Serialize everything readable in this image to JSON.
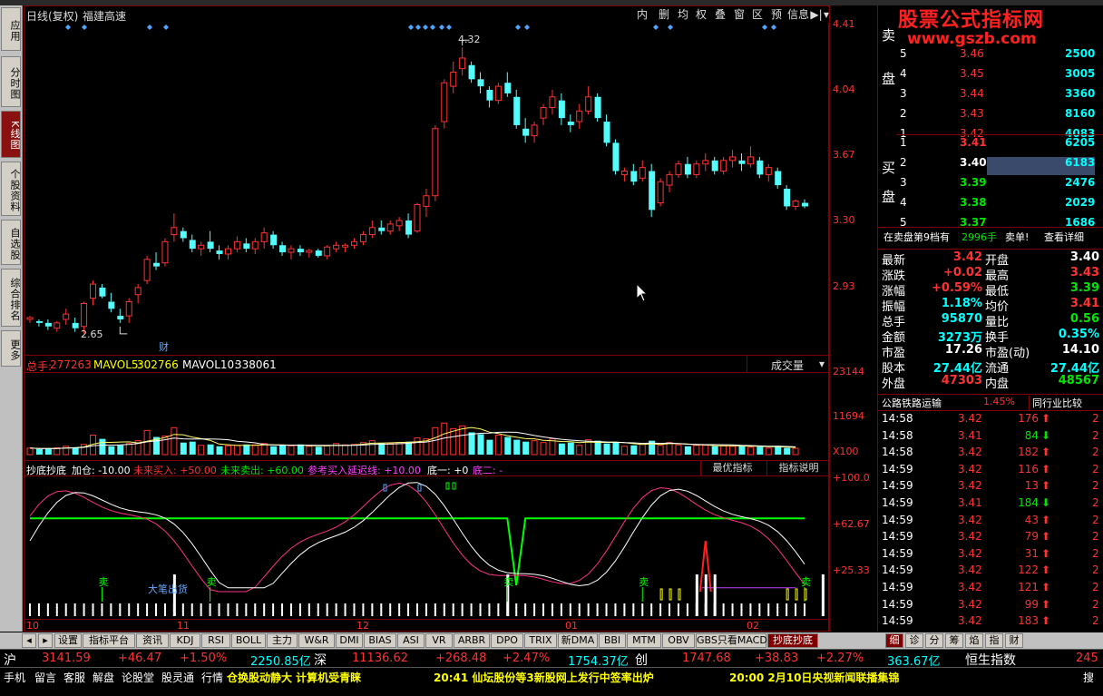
{
  "title": {
    "period": "日线(复权)",
    "stock": "福建高速"
  },
  "toolbar": [
    "内",
    "删",
    "均",
    "权",
    "叠",
    "窗",
    "区",
    "预",
    "信息",
    "▶|",
    "▾"
  ],
  "left_tabs": [
    {
      "label": "应用"
    },
    {
      "label": "分时图"
    },
    {
      "label": "K线图",
      "active": true
    },
    {
      "label": "个股资料"
    },
    {
      "label": "自选股"
    },
    {
      "label": "综合排名"
    },
    {
      "label": "更多"
    }
  ],
  "price_axis": [
    "4.41",
    "4.04",
    "3.67",
    "3.30",
    "2.93"
  ],
  "annotations": {
    "high": "4.32",
    "low": "2.65",
    "cai": "财"
  },
  "vol": {
    "zs_label": "总手:",
    "zs": "277263",
    "mavol5_label": "MAVOL5:",
    "mavol5": "302766",
    "mavol10_label": "MAVOL10:",
    "mavol10": "338061",
    "btn": "成交量",
    "axis": [
      "23144",
      "11694",
      "X100"
    ]
  },
  "ind": {
    "name": "抄底抄底",
    "p1": "加仓: -10.00",
    "p2": "未来买入: +50.00",
    "p3": "未来卖出: +60.00",
    "p4": "参考买入延迟线: +10.00",
    "p5": "底一: +0",
    "p6": "底二: -",
    "btn1": "最优指标",
    "btn2": "指标说明",
    "axis": [
      "+100.0",
      "+62.67",
      "+25.33"
    ],
    "sell": "卖",
    "bigsell": "大笔出货"
  },
  "months": [
    "10",
    "11",
    "12",
    "01",
    "02"
  ],
  "chart_data": {
    "type": "candlestick",
    "ylim": [
      2.6,
      4.45
    ],
    "candles": [
      [
        2.78,
        2.8,
        2.76,
        2.79
      ],
      [
        2.77,
        2.78,
        2.74,
        2.76
      ],
      [
        2.76,
        2.78,
        2.72,
        2.74
      ],
      [
        2.73,
        2.77,
        2.71,
        2.76
      ],
      [
        2.78,
        2.84,
        2.75,
        2.81
      ],
      [
        2.76,
        2.79,
        2.71,
        2.73
      ],
      [
        2.74,
        2.88,
        2.7,
        2.87
      ],
      [
        2.9,
        3.0,
        2.86,
        2.98
      ],
      [
        2.96,
        2.98,
        2.9,
        2.91
      ],
      [
        2.88,
        2.93,
        2.82,
        2.84
      ],
      [
        2.8,
        2.84,
        2.76,
        2.78
      ],
      [
        2.8,
        2.9,
        2.76,
        2.88
      ],
      [
        2.92,
        2.98,
        2.87,
        2.96
      ],
      [
        3.0,
        3.14,
        2.98,
        3.12
      ],
      [
        3.1,
        3.16,
        3.06,
        3.08
      ],
      [
        3.1,
        3.24,
        3.08,
        3.22
      ],
      [
        3.26,
        3.38,
        3.22,
        3.3
      ],
      [
        3.28,
        3.3,
        3.22,
        3.24
      ],
      [
        3.23,
        3.26,
        3.16,
        3.18
      ],
      [
        3.18,
        3.22,
        3.14,
        3.2
      ],
      [
        3.22,
        3.28,
        3.16,
        3.18
      ],
      [
        3.17,
        3.2,
        3.12,
        3.15
      ],
      [
        3.15,
        3.2,
        3.12,
        3.18
      ],
      [
        3.18,
        3.25,
        3.16,
        3.22
      ],
      [
        3.21,
        3.24,
        3.16,
        3.18
      ],
      [
        3.18,
        3.24,
        3.15,
        3.22
      ],
      [
        3.22,
        3.3,
        3.18,
        3.27
      ],
      [
        3.26,
        3.28,
        3.18,
        3.2
      ],
      [
        3.2,
        3.22,
        3.14,
        3.16
      ],
      [
        3.16,
        3.2,
        3.12,
        3.18
      ],
      [
        3.18,
        3.2,
        3.14,
        3.16
      ],
      [
        3.16,
        3.18,
        3.13,
        3.17
      ],
      [
        3.17,
        3.18,
        3.13,
        3.14
      ],
      [
        3.14,
        3.2,
        3.12,
        3.19
      ],
      [
        3.18,
        3.22,
        3.16,
        3.2
      ],
      [
        3.19,
        3.21,
        3.16,
        3.2
      ],
      [
        3.2,
        3.24,
        3.18,
        3.22
      ],
      [
        3.22,
        3.28,
        3.2,
        3.26
      ],
      [
        3.26,
        3.34,
        3.24,
        3.3
      ],
      [
        3.3,
        3.34,
        3.26,
        3.28
      ],
      [
        3.28,
        3.34,
        3.26,
        3.32
      ],
      [
        3.31,
        3.36,
        3.28,
        3.34
      ],
      [
        3.34,
        3.38,
        3.24,
        3.26
      ],
      [
        3.28,
        3.44,
        3.27,
        3.43
      ],
      [
        3.42,
        3.52,
        3.36,
        3.48
      ],
      [
        3.48,
        3.88,
        3.45,
        3.86
      ],
      [
        3.9,
        4.14,
        3.86,
        4.12
      ],
      [
        4.1,
        4.24,
        4.06,
        4.18
      ],
      [
        4.2,
        4.32,
        4.16,
        4.26
      ],
      [
        4.22,
        4.24,
        4.12,
        4.14
      ],
      [
        4.14,
        4.18,
        4.06,
        4.1
      ],
      [
        4.08,
        4.1,
        3.98,
        4.02
      ],
      [
        4.02,
        4.12,
        4.0,
        4.1
      ],
      [
        4.12,
        4.18,
        4.04,
        4.06
      ],
      [
        4.04,
        4.08,
        3.86,
        3.88
      ],
      [
        3.86,
        3.92,
        3.78,
        3.82
      ],
      [
        3.82,
        3.9,
        3.78,
        3.88
      ],
      [
        3.92,
        4.0,
        3.88,
        3.98
      ],
      [
        3.98,
        4.08,
        3.94,
        4.04
      ],
      [
        4.02,
        4.06,
        3.88,
        3.92
      ],
      [
        3.9,
        3.94,
        3.84,
        3.88
      ],
      [
        3.9,
        4.0,
        3.86,
        3.96
      ],
      [
        3.96,
        4.1,
        3.94,
        4.04
      ],
      [
        4.04,
        4.06,
        3.9,
        3.92
      ],
      [
        3.9,
        3.94,
        3.76,
        3.78
      ],
      [
        3.78,
        3.8,
        3.6,
        3.62
      ],
      [
        3.6,
        3.64,
        3.56,
        3.62
      ],
      [
        3.62,
        3.66,
        3.54,
        3.56
      ],
      [
        3.58,
        3.68,
        3.56,
        3.64
      ],
      [
        3.62,
        3.66,
        3.36,
        3.4
      ],
      [
        3.44,
        3.58,
        3.42,
        3.56
      ],
      [
        3.54,
        3.62,
        3.5,
        3.6
      ],
      [
        3.6,
        3.68,
        3.58,
        3.66
      ],
      [
        3.66,
        3.7,
        3.58,
        3.6
      ],
      [
        3.6,
        3.68,
        3.58,
        3.66
      ],
      [
        3.66,
        3.72,
        3.62,
        3.68
      ],
      [
        3.68,
        3.7,
        3.6,
        3.62
      ],
      [
        3.62,
        3.7,
        3.6,
        3.68
      ],
      [
        3.68,
        3.74,
        3.64,
        3.7
      ],
      [
        3.68,
        3.72,
        3.62,
        3.66
      ],
      [
        3.66,
        3.76,
        3.64,
        3.7
      ],
      [
        3.68,
        3.7,
        3.58,
        3.6
      ],
      [
        3.6,
        3.66,
        3.56,
        3.64
      ],
      [
        3.62,
        3.64,
        3.52,
        3.54
      ],
      [
        3.52,
        3.54,
        3.4,
        3.42
      ],
      [
        3.42,
        3.46,
        3.4,
        3.45
      ],
      [
        3.44,
        3.46,
        3.41,
        3.42
      ]
    ],
    "volume_max": 23144,
    "volumes": [
      700,
      600,
      650,
      720,
      900,
      800,
      1100,
      2100,
      1700,
      900,
      1000,
      1200,
      1500,
      2600,
      1900,
      2000,
      2900,
      1300,
      1400,
      1000,
      1100,
      900,
      950,
      1000,
      1100,
      1050,
      1200,
      900,
      1000,
      950,
      1100,
      900,
      850,
      950,
      1200,
      1050,
      1100,
      1300,
      1500,
      1250,
      1200,
      1300,
      1400,
      1800,
      1700,
      2900,
      3400,
      2800,
      3100,
      2400,
      2200,
      1600,
      2100,
      1900,
      1600,
      1400,
      1500,
      1300,
      1700,
      1200,
      1300,
      1000,
      1600,
      1500,
      1200,
      1300,
      900,
      1000,
      1100,
      1500,
      1000,
      1300,
      1050,
      900,
      1000,
      1000,
      900,
      950,
      900,
      1000,
      800,
      850,
      700,
      950,
      720,
      680
    ],
    "ma_lines": [
      "MAVOL5",
      "MAVOL10"
    ],
    "indicator_axis": [
      25.33,
      62.67,
      100
    ],
    "sell_marks": [
      9,
      21,
      59,
      75,
      100
    ],
    "mark_label": "卖"
  },
  "quote": {
    "ask_label": [
      "卖",
      "盘"
    ],
    "bid_label": [
      "买",
      "盘"
    ],
    "asks": [
      [
        "5",
        "3.46",
        "2500"
      ],
      [
        "4",
        "3.45",
        "3005"
      ],
      [
        "3",
        "3.44",
        "3360"
      ],
      [
        "2",
        "3.43",
        "8160"
      ],
      [
        "1",
        "3.42",
        "4083"
      ]
    ],
    "bids": [
      [
        "1",
        "3.41",
        "6205"
      ],
      [
        "2",
        "3.40",
        "6183"
      ],
      [
        "3",
        "3.39",
        "2476"
      ],
      [
        "4",
        "3.38",
        "2029"
      ],
      [
        "5",
        "3.37",
        "1686"
      ]
    ],
    "level9": "在卖盘第9档有",
    "level9_qty": "2996手",
    "sell_btn": "卖单!",
    "detail_btn": "查看详细",
    "stats": [
      [
        "最新",
        "3.42",
        "开盘",
        "3.40"
      ],
      [
        "涨跌",
        "+0.02",
        "最高",
        "3.43"
      ],
      [
        "涨幅",
        "+0.59%",
        "最低",
        "3.39"
      ],
      [
        "振幅",
        "1.18%",
        "均价",
        "3.41"
      ],
      [
        "总手",
        "95870",
        "量比",
        "0.56"
      ],
      [
        "金额",
        "3273万",
        "换手",
        "0.35%"
      ],
      [
        "市盈",
        "17.26",
        "市盈(动)",
        "14.10"
      ],
      [
        "股本",
        "27.44亿",
        "流通",
        "27.44亿"
      ],
      [
        "外盘",
        "47303",
        "内盘",
        "48567"
      ]
    ],
    "industry": "公路铁路运输",
    "industry_pct": "1.45%",
    "industry_btn": "同行业比较",
    "ticks": [
      [
        "14:58",
        "3.42",
        "176",
        "up",
        "2"
      ],
      [
        "14:58",
        "3.41",
        "84",
        "down",
        "2"
      ],
      [
        "14:58",
        "3.42",
        "182",
        "up",
        "2"
      ],
      [
        "14:59",
        "3.42",
        "116",
        "up",
        "2"
      ],
      [
        "14:59",
        "3.42",
        "13",
        "up",
        "2"
      ],
      [
        "14:59",
        "3.41",
        "184",
        "down",
        "2"
      ],
      [
        "14:59",
        "3.42",
        "43",
        "up",
        "2"
      ],
      [
        "14:59",
        "3.42",
        "79",
        "up",
        "2"
      ],
      [
        "14:59",
        "3.42",
        "31",
        "up",
        "2"
      ],
      [
        "14:59",
        "3.42",
        "122",
        "up",
        "2"
      ],
      [
        "14:59",
        "3.42",
        "121",
        "up",
        "2"
      ],
      [
        "14:59",
        "3.42",
        "99",
        "up",
        "2"
      ],
      [
        "14:59",
        "3.42",
        "183",
        "up",
        "2"
      ]
    ]
  },
  "bottom_tabs": [
    "设置",
    "指标平台",
    "资讯",
    "KDJ",
    "RSI",
    "BOLL",
    "主力",
    "W&R",
    "DMI",
    "BIAS",
    "ASI",
    "VR",
    "ARBR",
    "DPO",
    "TRIX",
    "新DMA",
    "BBI",
    "MTM",
    "OBV",
    "GBS只看MACD",
    "抄底抄底"
  ],
  "right_tabs": [
    "细",
    "诊",
    "分",
    "筹",
    "焰",
    "指",
    "财"
  ],
  "index": {
    "sh": "沪",
    "sh_val": "3141.59",
    "sh_chg": "+46.47",
    "sh_pct": "+1.50%",
    "sh_amt": "2250.85亿",
    "sz": "深",
    "sz_val": "11136.62",
    "sz_chg": "+268.48",
    "sz_pct": "+2.47%",
    "sz_amt": "1754.37亿",
    "cy": "创",
    "cy_val": "1747.68",
    "cy_chg": "+38.83",
    "cy_pct": "+2.27%",
    "cy_amt": "363.67亿",
    "hs": "恒生指数",
    "hs_val": "245"
  },
  "news": {
    "items": [
      "手机",
      "留言",
      "客服",
      "解盘",
      "论股堂",
      "股灵通",
      "行情"
    ],
    "t1": "仓换股动静大 计算机受青睐",
    "t2": "20:41 仙坛股份等3新股网上发行中签率出炉",
    "t3": "20:00 2月10日央视新闻联播集锦",
    "search": "搜"
  },
  "watermark": {
    "line1": "股票公式指标网",
    "line2": "www.gszb.com"
  }
}
